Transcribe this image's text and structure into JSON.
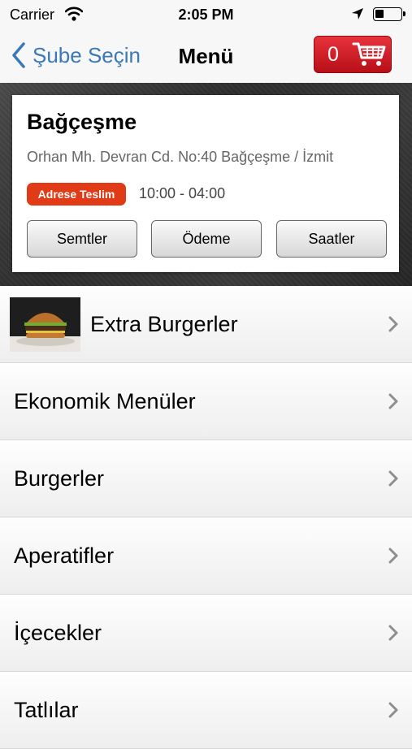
{
  "status_bar": {
    "carrier": "Carrier",
    "time": "2:05 PM"
  },
  "nav": {
    "back_label": "Şube Seçin",
    "title": "Menü",
    "cart_count": "0"
  },
  "branch": {
    "name": "Bağçeşme",
    "address": "Orhan Mh. Devran Cd. No:40 Bağçeşme / İzmit",
    "badge": "Adrese Teslim",
    "hours": "10:00 - 04:00",
    "buttons": [
      "Semtler",
      "Ödeme",
      "Saatler"
    ]
  },
  "menu": [
    {
      "label": "Extra Burgerler"
    },
    {
      "label": "Ekonomik Menüler"
    },
    {
      "label": "Burgerler"
    },
    {
      "label": "Aperatifler"
    },
    {
      "label": "İçecekler"
    },
    {
      "label": "Tatlılar"
    }
  ],
  "colors": {
    "accent_blue": "#3a79b7",
    "cart_red": "#d81f28",
    "badge_red": "#e03a16"
  }
}
